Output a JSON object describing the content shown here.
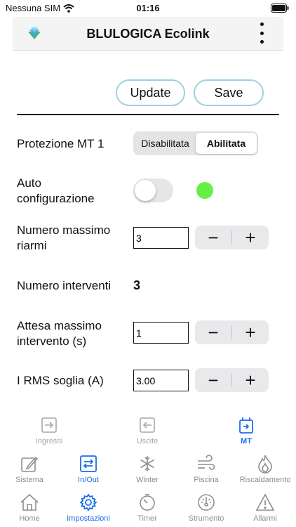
{
  "status_bar": {
    "carrier": "Nessuna SIM",
    "time": "01:16"
  },
  "header": {
    "title": "BLULOGICA Ecolink"
  },
  "actions": {
    "update": "Update",
    "save": "Save"
  },
  "protezione": {
    "label": "Protezione MT 1",
    "options": [
      "Disabilitata",
      "Abilitata"
    ],
    "selected": "Abilitata"
  },
  "auto_config": {
    "label_line1": "Auto",
    "label_line2": "configurazione",
    "enabled": false,
    "status_color": "#66ef44"
  },
  "riarmi": {
    "label_line1": "Numero massimo",
    "label_line2": "riarmi",
    "value": "3"
  },
  "interventi": {
    "label": "Numero interventi",
    "value": "3"
  },
  "attesa": {
    "label_line1": "Attesa massimo",
    "label_line2": "intervento (s)",
    "value": "1"
  },
  "irms": {
    "label": "I RMS soglia (A)",
    "value": "3.00"
  },
  "stepper": {
    "minus": "−",
    "plus": "+"
  },
  "tabs_row1": [
    {
      "label": "Ingressi",
      "icon": "arrow-right-box-icon"
    },
    {
      "label": "Uscite",
      "icon": "arrow-left-box-icon"
    },
    {
      "label": "MT",
      "icon": "mt-device-icon",
      "active": true
    }
  ],
  "tabs_row2": [
    {
      "label": "Sistema",
      "icon": "edit-square-icon"
    },
    {
      "label": "In/Out",
      "icon": "in-out-icon",
      "active": true
    },
    {
      "label": "Winter",
      "icon": "snowflake-icon"
    },
    {
      "label": "Piscina",
      "icon": "wind-icon"
    },
    {
      "label": "Riscaldamento",
      "icon": "flame-icon"
    }
  ],
  "tabs_row3": [
    {
      "label": "Home",
      "icon": "house-icon"
    },
    {
      "label": "Impostazioni",
      "icon": "gear-icon",
      "active": true
    },
    {
      "label": "Timer",
      "icon": "timer-icon"
    },
    {
      "label": "Strumento",
      "icon": "gauge-icon"
    },
    {
      "label": "Allarmi",
      "icon": "warning-icon"
    }
  ],
  "colors": {
    "accent": "#1a6fe8",
    "button_border": "#9ed0e0",
    "led_on": "#66ef44"
  }
}
